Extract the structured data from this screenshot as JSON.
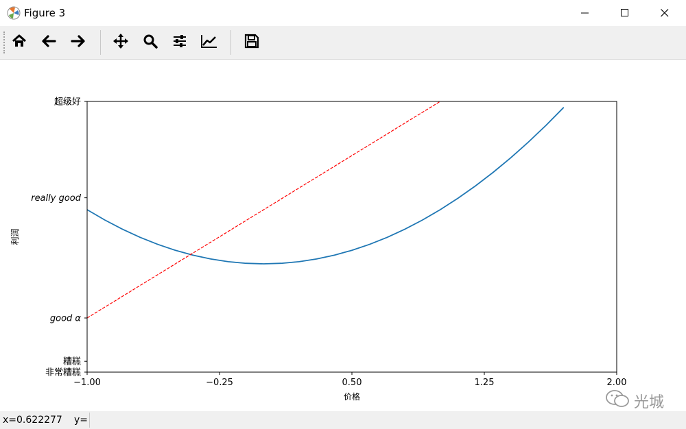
{
  "window": {
    "title": "Figure 3",
    "controls": [
      "minimize",
      "maximize",
      "close"
    ]
  },
  "toolbar": {
    "buttons": [
      {
        "name": "home",
        "icon": "home-icon"
      },
      {
        "name": "back",
        "icon": "arrow-left-icon"
      },
      {
        "name": "forward",
        "icon": "arrow-right-icon"
      },
      {
        "name": "pan",
        "icon": "move-icon"
      },
      {
        "name": "zoom",
        "icon": "magnifier-icon"
      },
      {
        "name": "configure-subplots",
        "icon": "sliders-icon"
      },
      {
        "name": "edit-axes",
        "icon": "chart-line-icon"
      },
      {
        "name": "save",
        "icon": "floppy-disk-icon"
      }
    ]
  },
  "status": {
    "x_label": "x=0.622277",
    "y_label": "y="
  },
  "watermark": {
    "text": "光城"
  },
  "chart_data": {
    "type": "line",
    "xlabel": "价格",
    "ylabel": "利润",
    "xlim": [
      -1.0,
      2.0
    ],
    "ylim": [
      -2.0,
      3.0
    ],
    "grid": false,
    "xticks": [
      -1.0,
      -0.25,
      0.5,
      1.25,
      2.0
    ],
    "xtick_labels": [
      "−1.00",
      "−0.25",
      "0.50",
      "1.25",
      "2.00"
    ],
    "yticks": [
      -2.0,
      -1.8,
      -1.0,
      1.22,
      3.0
    ],
    "ytick_labels": [
      "非常糟糕",
      "糟糕",
      "good α",
      "really good",
      "超级好"
    ],
    "series": [
      {
        "style": "solid",
        "color": "#1f77b4",
        "x": [
          -1.0,
          -0.9,
          -0.8,
          -0.7,
          -0.6,
          -0.5,
          -0.4,
          -0.3,
          -0.2,
          -0.1,
          0.0,
          0.1,
          0.2,
          0.3,
          0.4,
          0.5,
          0.6,
          0.7,
          0.8,
          0.9,
          1.0,
          1.1,
          1.2,
          1.3,
          1.4,
          1.5,
          1.6,
          1.7
        ],
        "y": [
          1.0,
          0.81,
          0.64,
          0.49,
          0.36,
          0.25,
          0.16,
          0.09,
          0.04,
          0.01,
          0.0,
          0.01,
          0.04,
          0.09,
          0.16,
          0.25,
          0.36,
          0.49,
          0.64,
          0.81,
          1.0,
          1.21,
          1.44,
          1.69,
          1.96,
          2.25,
          2.56,
          2.89
        ]
      },
      {
        "style": "dashed",
        "color": "#ff0000",
        "x": [
          -1.0,
          1.0
        ],
        "y": [
          -1.0,
          3.0
        ]
      }
    ]
  }
}
